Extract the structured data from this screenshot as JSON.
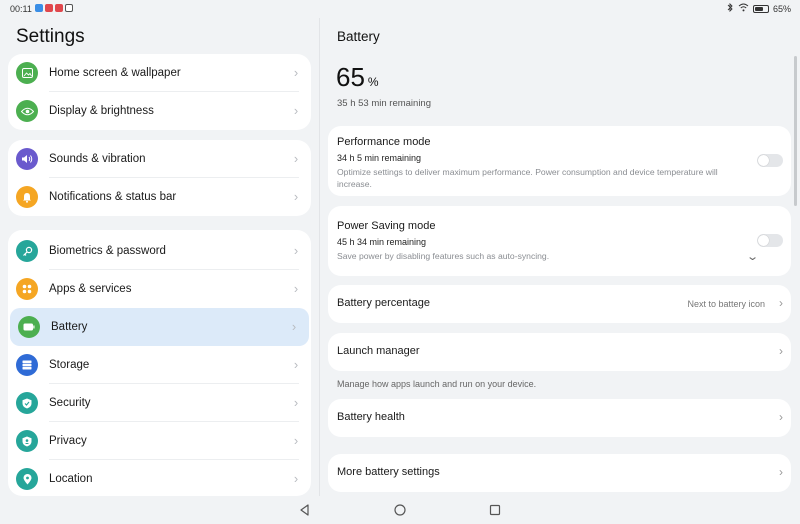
{
  "status_bar": {
    "time": "00:11",
    "battery_text": "65%",
    "battery_level": 0.65,
    "notification_colors": [
      "#3a8ee6",
      "#e0474c",
      "#e0474c",
      "#555555"
    ]
  },
  "left": {
    "title": "Settings",
    "groups": [
      [
        {
          "label": "Home screen & wallpaper",
          "icon": "image-icon",
          "color": "#4caf50"
        },
        {
          "label": "Display & brightness",
          "icon": "eye-icon",
          "color": "#4caf50"
        }
      ],
      [
        {
          "label": "Sounds & vibration",
          "icon": "speaker-icon",
          "color": "#6a5acd"
        },
        {
          "label": "Notifications & status bar",
          "icon": "bell-icon",
          "color": "#f5a623"
        }
      ],
      [
        {
          "label": "Biometrics & password",
          "icon": "key-icon",
          "color": "#26a69a"
        },
        {
          "label": "Apps & services",
          "icon": "grid-icon",
          "color": "#f5a623"
        },
        {
          "label": "Battery",
          "icon": "battery-icon",
          "color": "#4caf50",
          "selected": true
        },
        {
          "label": "Storage",
          "icon": "storage-icon",
          "color": "#2f6bd6"
        },
        {
          "label": "Security",
          "icon": "shield-icon",
          "color": "#26a69a"
        },
        {
          "label": "Privacy",
          "icon": "privacy-icon",
          "color": "#26a69a"
        },
        {
          "label": "Location",
          "icon": "location-icon",
          "color": "#26a69a"
        }
      ]
    ]
  },
  "right": {
    "title": "Battery",
    "percent": "65",
    "percent_unit": "%",
    "remaining": "35 h 53 min remaining",
    "performance": {
      "title": "Performance mode",
      "sub": "34 h 5 min remaining",
      "desc": "Optimize settings to deliver maximum performance. Power consumption and device temperature will increase."
    },
    "power_saving": {
      "title": "Power Saving mode",
      "sub": "45 h 34 min remaining",
      "desc": "Save power by disabling features such as auto-syncing."
    },
    "battery_percentage": {
      "title": "Battery percentage",
      "value": "Next to battery icon"
    },
    "launch_manager": {
      "title": "Launch manager",
      "note": "Manage how apps launch and run on your device."
    },
    "battery_health": {
      "title": "Battery health"
    },
    "more_settings": {
      "title": "More battery settings"
    }
  }
}
